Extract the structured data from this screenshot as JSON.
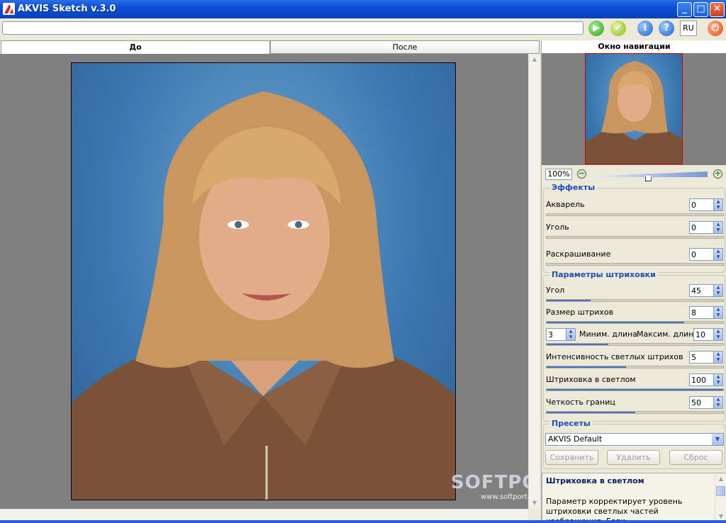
{
  "window": {
    "title": "AKVIS Sketch v.3.0",
    "controls": {
      "minimize": "_",
      "maximize": "□",
      "close": "✕"
    }
  },
  "toolbar": {
    "path_value": "",
    "lang": "RU",
    "icons": [
      "run-icon",
      "apply-icon",
      "info-icon",
      "help-icon",
      "power-icon"
    ]
  },
  "tabs": {
    "before": "До",
    "after": "После"
  },
  "navigation": {
    "title": "Окно навигации",
    "zoom": "100%",
    "zoom_level": 0.48
  },
  "effects": {
    "legend": "Эффекты",
    "items": [
      {
        "label": "Акварель",
        "value": "0",
        "level": 0.0
      },
      {
        "label": "Уголь",
        "value": "0",
        "level": 0.0
      },
      {
        "label": "Раскрашивание",
        "value": "0",
        "level": 0.0
      }
    ]
  },
  "hatching": {
    "legend": "Параметры штриховки",
    "angle": {
      "label": "Угол",
      "value": "45",
      "level": 0.25
    },
    "stroke_size": {
      "label": "Размер штрихов",
      "value": "8",
      "level": 0.78
    },
    "min_length": {
      "label": "Миним. длина",
      "value": "3"
    },
    "max_length": {
      "label": "Максим. длина",
      "value": "10"
    },
    "length_level": 0.35,
    "light_intensity": {
      "label": "Интенсивность светлых штрихов",
      "value": "5",
      "level": 0.45
    },
    "light_hatching": {
      "label": "Штриховка в светлом",
      "value": "100",
      "level": 1.0
    },
    "edge_sharpness": {
      "label": "Четкость границ",
      "value": "50",
      "level": 0.5
    }
  },
  "presets": {
    "legend": "Пресеты",
    "selected": "AKVIS Default",
    "save": "Сохранить",
    "delete": "Удалить",
    "reset": "Сброс"
  },
  "help": {
    "title": "Штриховка в светлом",
    "text": "Параметр корректирует уровень штриховки светлых частей изображения. Если"
  },
  "watermark": {
    "logo": "SOFTPORTAL",
    "url": "www.softportal.com"
  }
}
